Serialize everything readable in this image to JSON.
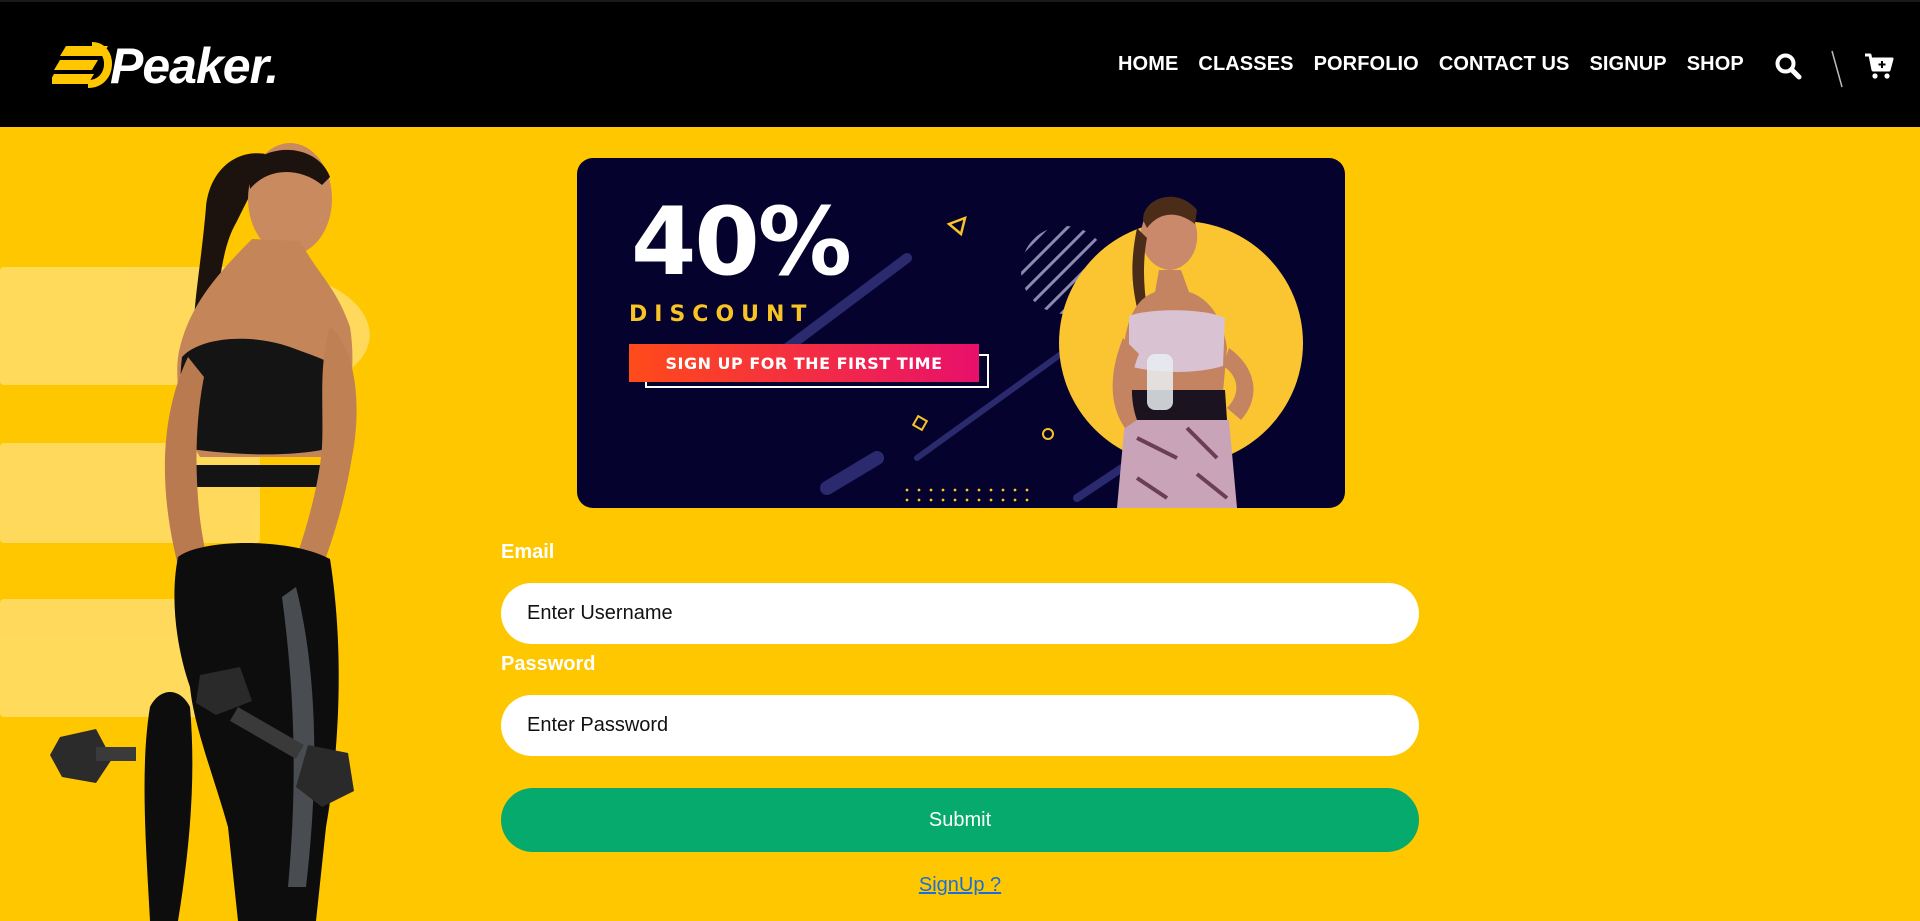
{
  "brand": {
    "name": "Peaker.",
    "accent": "#FFC700",
    "header_bg": "#000000"
  },
  "nav": {
    "items": [
      {
        "label": "HOME"
      },
      {
        "label": "CLASSES"
      },
      {
        "label": "PORFOLIO"
      },
      {
        "label": "CONTACT US"
      },
      {
        "label": "SIGNUP"
      },
      {
        "label": "SHOP"
      }
    ],
    "icons": [
      "search-icon",
      "cart-icon"
    ]
  },
  "banner": {
    "percent": "40%",
    "discount": "DISCOUNT",
    "cta": "SIGN UP FOR THE FIRST TIME",
    "bg": "#05032e",
    "circle": "#FBC531"
  },
  "form": {
    "email_label": "Email",
    "email_placeholder": "Enter Username",
    "password_label": "Password",
    "password_placeholder": "Enter Password",
    "submit_label": "Submit",
    "signup_link": "SignUp ?",
    "submit_color": "#05AA6C"
  }
}
